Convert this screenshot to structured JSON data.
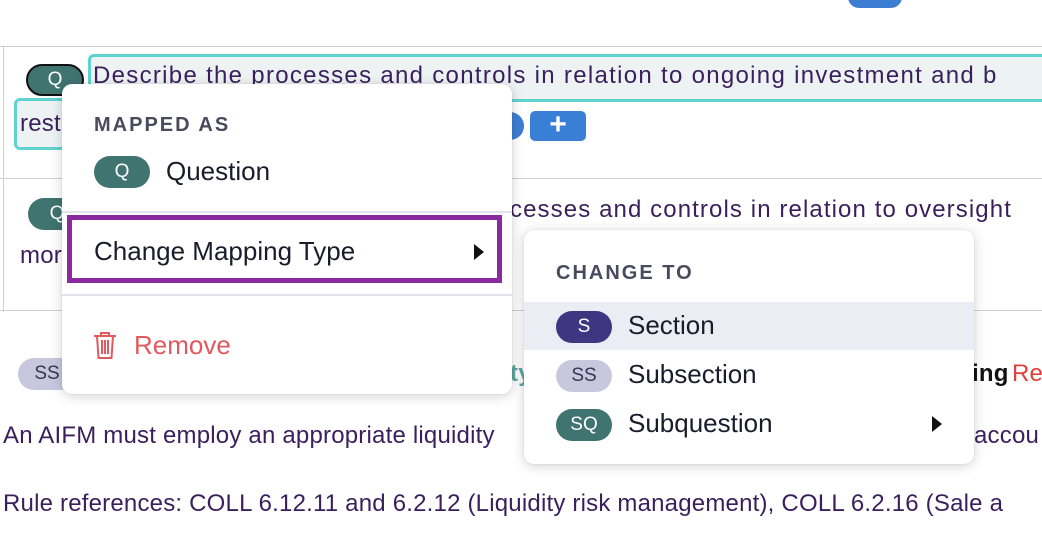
{
  "document": {
    "row1_text": "Describe the processes and controls in relation to ongoing investment and b",
    "row1_cont": "rest",
    "row2_text": "cesses and controls in relation to oversight",
    "row2_cont": "mor",
    "heading_fragment_left": "ty",
    "heading_fragment_right": "ing",
    "heading_fragment_red": "Re",
    "para1": "An AIFM must employ an appropriate liquidity",
    "para1_right": "accou",
    "para2": "Rule references: COLL 6.12.11 and 6.2.12 (Liquidity risk management), COLL 6.2.16 (Sale a",
    "row1_badge": "Q",
    "row2_badge": "Q",
    "row3_badge": "SS",
    "plus_label": "+"
  },
  "context_menu": {
    "heading": "MAPPED AS",
    "current_badge": "Q",
    "current_label": "Question",
    "change_label": "Change Mapping Type",
    "remove_label": "Remove"
  },
  "submenu": {
    "heading": "CHANGE TO",
    "options": [
      {
        "badge": "S",
        "label": "Section"
      },
      {
        "badge": "SS",
        "label": "Subsection"
      },
      {
        "badge": "SQ",
        "label": "Subquestion"
      }
    ]
  },
  "colors": {
    "accent_purple": "#8a2a9e",
    "remove_red": "#e05a5f",
    "question_green": "#3f7471",
    "section_navy": "#3f3682"
  }
}
